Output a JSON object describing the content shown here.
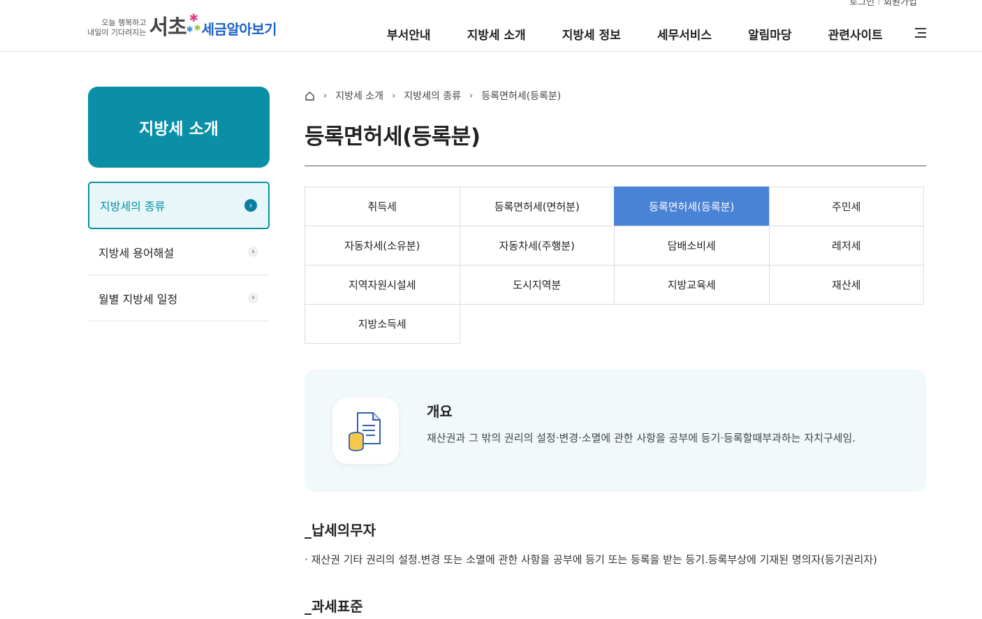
{
  "util": {
    "login": "로그인",
    "signup": "회원가입"
  },
  "logo": {
    "tagline_1": "오늘 행복하고",
    "tagline_2": "내일이 기다려지는",
    "brand": "서초",
    "service": "세금알아보기"
  },
  "gnb": [
    "부서안내",
    "지방세 소개",
    "지방세 정보",
    "세무서비스",
    "알림마당",
    "관련사이트"
  ],
  "sidebar": {
    "title": "지방세 소개",
    "items": [
      {
        "label": "지방세의 종류",
        "active": true
      },
      {
        "label": "지방세 용어해설",
        "active": false
      },
      {
        "label": "월별 지방세 일정",
        "active": false
      }
    ]
  },
  "breadcrumb": [
    "지방세 소개",
    "지방세의 종류",
    "등록면허세(등록분)"
  ],
  "page_title": "등록면허세(등록분)",
  "tabs": [
    [
      "취득세",
      "등록면허세(면허분)",
      "등록면허세(등록분)",
      "주민세"
    ],
    [
      "자동차세(소유분)",
      "자동차세(주행분)",
      "담배소비세",
      "레저세"
    ],
    [
      "지역자원시설세",
      "도시지역분",
      "지방교육세",
      "재산세"
    ],
    [
      "지방소득세"
    ]
  ],
  "active_tab": "등록면허세(등록분)",
  "overview": {
    "title": "개요",
    "description": "재산권과 그 밖의 권리의 설정·변경·소멸에 관한 사항을 공부에 등기·등록할때부과하는 자치구세임."
  },
  "sections": [
    {
      "title": "_납세의무자",
      "text": "· 재산권 기타 권리의 설정.변경 또는 소멸에 관한 사항을 공부에 등기 또는 등록을 받는 등기.등록부상에 기재된 명의자(등기권리자)"
    },
    {
      "title": "_과세표준",
      "text": ""
    }
  ],
  "colors": {
    "teal": "#0a8fa6",
    "active_tab": "#4a82d6",
    "logo_blue": "#1b62c5"
  }
}
